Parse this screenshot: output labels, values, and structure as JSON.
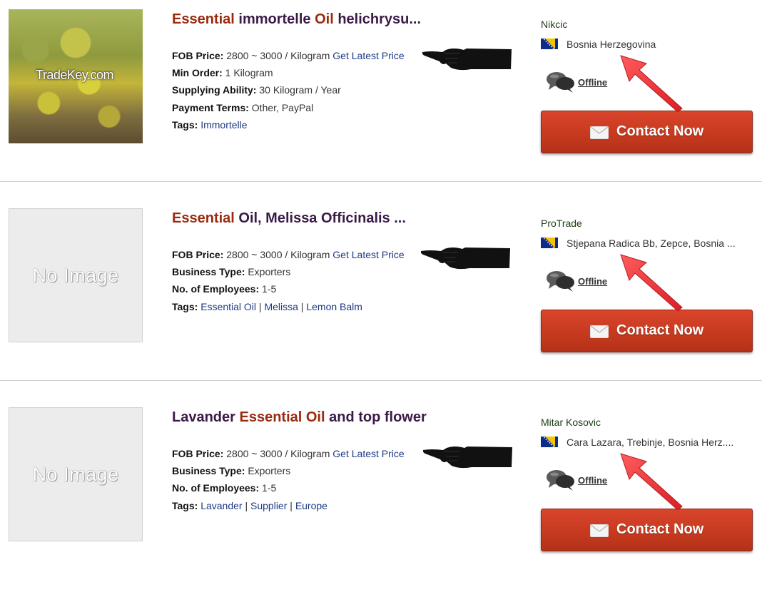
{
  "listings": [
    {
      "image": {
        "type": "photo",
        "watermark": "TradeKey.com"
      },
      "title": [
        {
          "text": "Essential",
          "highlight": true
        },
        {
          "text": " immortelle ",
          "highlight": false
        },
        {
          "text": "Oil",
          "highlight": true
        },
        {
          "text": " helichrysu...",
          "highlight": false
        }
      ],
      "specs": [
        {
          "key": "FOB Price:",
          "value": "2800 ~ 3000 / Kilogram",
          "link": "Get Latest Price"
        },
        {
          "key": "Min Order:",
          "value": "1 Kilogram"
        },
        {
          "key": "Supplying Ability:",
          "value": "30 Kilogram / Year"
        },
        {
          "key": "Payment Terms:",
          "value": "Other, PayPal"
        }
      ],
      "tags_label": "Tags:",
      "tags": [
        "Immortelle"
      ],
      "seller": "Nikcic",
      "location": "Bosnia Herzegovina",
      "status": "Offline",
      "contact_label": "Contact Now"
    },
    {
      "image": {
        "type": "none",
        "placeholder": "No Image"
      },
      "title": [
        {
          "text": "Essential",
          "highlight": true
        },
        {
          "text": " Oil, Melissa Officinalis ...",
          "highlight": false
        }
      ],
      "specs": [
        {
          "key": "FOB Price:",
          "value": "2800 ~ 3000 / Kilogram",
          "link": "Get Latest Price"
        },
        {
          "key": "Business Type:",
          "value": "Exporters"
        },
        {
          "key": "No. of Employees:",
          "value": "1-5"
        }
      ],
      "tags_label": "Tags:",
      "tags": [
        "Essential Oil",
        "Melissa",
        "Lemon Balm"
      ],
      "seller": "ProTrade",
      "location": "Stjepana Radica Bb, Zepce, Bosnia ...",
      "status": "Offline",
      "contact_label": "Contact Now"
    },
    {
      "image": {
        "type": "none",
        "placeholder": "No Image"
      },
      "title": [
        {
          "text": "Lavander ",
          "highlight": false
        },
        {
          "text": "Essential Oil",
          "highlight": true
        },
        {
          "text": " and top flower",
          "highlight": false
        }
      ],
      "specs": [
        {
          "key": "FOB Price:",
          "value": "2800 ~ 3000 / Kilogram",
          "link": "Get Latest Price"
        },
        {
          "key": "Business Type:",
          "value": "Exporters"
        },
        {
          "key": "No. of Employees:",
          "value": "1-5"
        }
      ],
      "tags_label": "Tags:",
      "tags": [
        "Lavander",
        "Supplier",
        "Europe"
      ],
      "seller": "Mitar Kosovic",
      "location": "Cara Lazara, Trebinje, Bosnia Herz....",
      "status": "Offline",
      "contact_label": "Contact Now"
    }
  ],
  "colors": {
    "title_text": "#3b1a47",
    "title_highlight": "#9a2a10",
    "link": "#1c3a82",
    "seller": "#1a3d12",
    "contact_button": "#c73a1f",
    "annotation_arrow": "#e8333a"
  },
  "icons": {
    "pointer": "pointing-hand-icon",
    "flag": "bosnia-flag-icon",
    "chat": "chat-bubbles-icon",
    "mail": "envelope-icon",
    "annotation": "red-arrow-icon"
  }
}
